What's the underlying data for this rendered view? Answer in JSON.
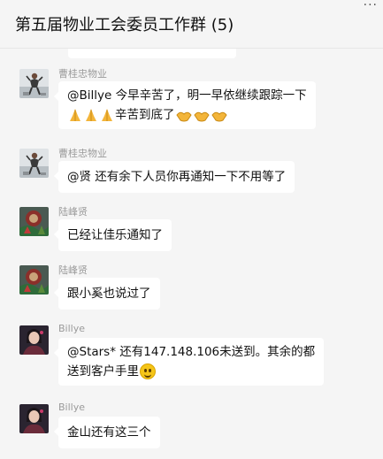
{
  "header": {
    "title": "第五届物业工会委员工作群 (5)",
    "more_glyph": "···"
  },
  "messages": [
    {
      "sender": "曹桂忠物业",
      "avatar": "photo-avatar-cao",
      "lines": [
        "@Billye 今早辛苦了，明一早依继续跟踪一下",
        "辛苦到底了"
      ],
      "emoji": [
        "pray-emoji",
        "handshake-emoji"
      ]
    },
    {
      "sender": "曹桂忠物业",
      "avatar": "photo-avatar-cao",
      "lines": [
        "@贤 还有余下人员你再通知一下不用等了"
      ]
    },
    {
      "sender": "陆峰贤",
      "avatar": "photo-avatar-lu",
      "lines": [
        "已经让佳乐通知了"
      ]
    },
    {
      "sender": "陆峰贤",
      "avatar": "photo-avatar-lu",
      "lines": [
        "跟小奚也说过了"
      ]
    },
    {
      "sender": "Billye",
      "avatar": "photo-avatar-billye",
      "lines": [
        "@Stars* 还有147.148.106未送到。其余的都",
        "送到客户手里"
      ],
      "emoji": [
        "smile-emoji"
      ]
    },
    {
      "sender": "Billye",
      "avatar": "photo-avatar-billye",
      "lines": [
        "金山还有这三个"
      ]
    }
  ],
  "colors": {
    "background": "#f5f5f5",
    "bubble": "#ffffff",
    "sender_text": "#9a9a9a"
  }
}
